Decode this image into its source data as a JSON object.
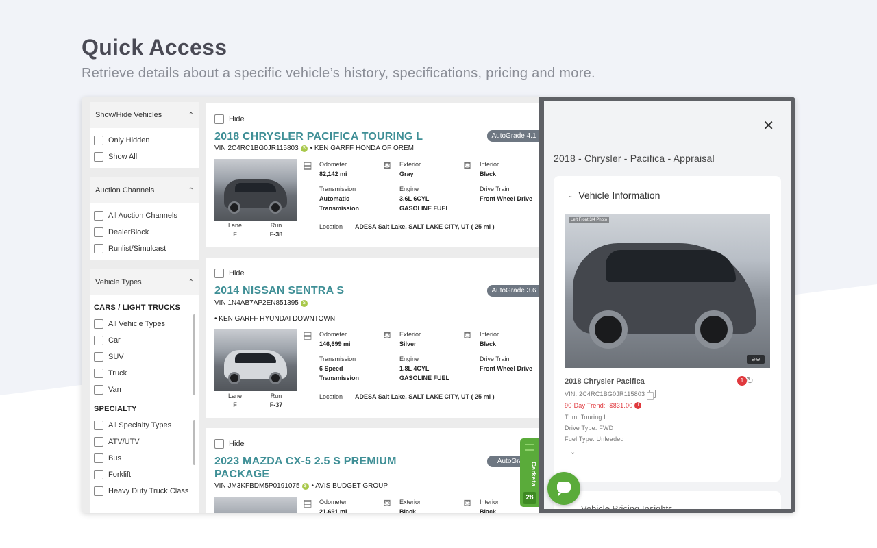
{
  "hero": {
    "title": "Quick Access",
    "subtitle": "Retrieve details about a specific vehicle’s history, specifications, pricing and more."
  },
  "sidebar": {
    "show_hide": {
      "title": "Show/Hide Vehicles",
      "options": [
        "Only Hidden",
        "Show All"
      ]
    },
    "channels": {
      "title": "Auction Channels",
      "options": [
        "All Auction Channels",
        "DealerBlock",
        "Runlist/Simulcast"
      ]
    },
    "types": {
      "title": "Vehicle Types",
      "cars_label": "CARS / LIGHT TRUCKS",
      "cars": [
        "All Vehicle Types",
        "Car",
        "SUV",
        "Truck",
        "Van"
      ],
      "specialty_label": "SPECIALTY",
      "specialty": [
        "All Specialty Types",
        "ATV/UTV",
        "Bus",
        "Forklift",
        "Heavy Duty Truck Class"
      ]
    }
  },
  "labels": {
    "hide": "Hide",
    "lane": "Lane",
    "run": "Run",
    "odometer": "Odometer",
    "exterior": "Exterior",
    "interior": "Interior",
    "transmission": "Transmission",
    "engine": "Engine",
    "drive_train": "Drive Train",
    "location": "Location"
  },
  "listings": [
    {
      "title": "2018 CHRYSLER PACIFICA TOURING L",
      "vin": "VIN 2C4RC1BG0JR115803",
      "seller": "• KEN GARFF HONDA OF OREM",
      "grade": "AutoGrade 4.1",
      "lane": "F",
      "run": "F-38",
      "odometer": "82,142 mi",
      "exterior": "Gray",
      "interior": "Black",
      "transmission": "Automatic",
      "transmission2": "Transmission",
      "engine": "3.6L 6CYL",
      "engine2": "GASOLINE FUEL",
      "drive_train": "Front Wheel Drive",
      "location": "ADESA Salt Lake, SALT LAKE CITY, UT ( 25 mi )"
    },
    {
      "title": "2014 NISSAN SENTRA S",
      "vin": "VIN 1N4AB7AP2EN851395",
      "seller": "• KEN GARFF HYUNDAI DOWNTOWN",
      "grade": "AutoGrade 3.6",
      "lane": "F",
      "run": "F-37",
      "odometer": "146,699 mi",
      "exterior": "Silver",
      "interior": "Black",
      "transmission": "6 Speed",
      "transmission2": "Transmission",
      "engine": "1.8L 4CYL",
      "engine2": "GASOLINE FUEL",
      "drive_train": "Front Wheel Drive",
      "location": "ADESA Salt Lake, SALT LAKE CITY, UT ( 25 mi )"
    },
    {
      "title": "2023 MAZDA CX-5 2.5 S PREMIUM",
      "title2": "PACKAGE",
      "vin": "VIN JM3KFBDM5P0191075",
      "seller": "• AVIS BUDGET GROUP",
      "grade": "AutoGrade",
      "odometer": "21,691 mi",
      "exterior": "Black",
      "interior": "Black"
    }
  ],
  "carketa": {
    "label": "Carketa",
    "count": "28"
  },
  "panel": {
    "title": "2018 - Chrysler - Pacifica - Appraisal",
    "section": "Vehicle Information",
    "photo_tag": "Left Front 3/4 Photo",
    "vehicle_name": "2018 Chrysler Pacifica",
    "badge": "1",
    "vin": "VIN: 2C4RC1BG0JR115803",
    "trend": "90-Day Trend: -$831.00",
    "trim": "Trim: Touring L",
    "drive": "Drive Type: FWD",
    "fuel": "Fuel Type: Unleaded",
    "next_section": "Vehicle Pricing Insights"
  }
}
